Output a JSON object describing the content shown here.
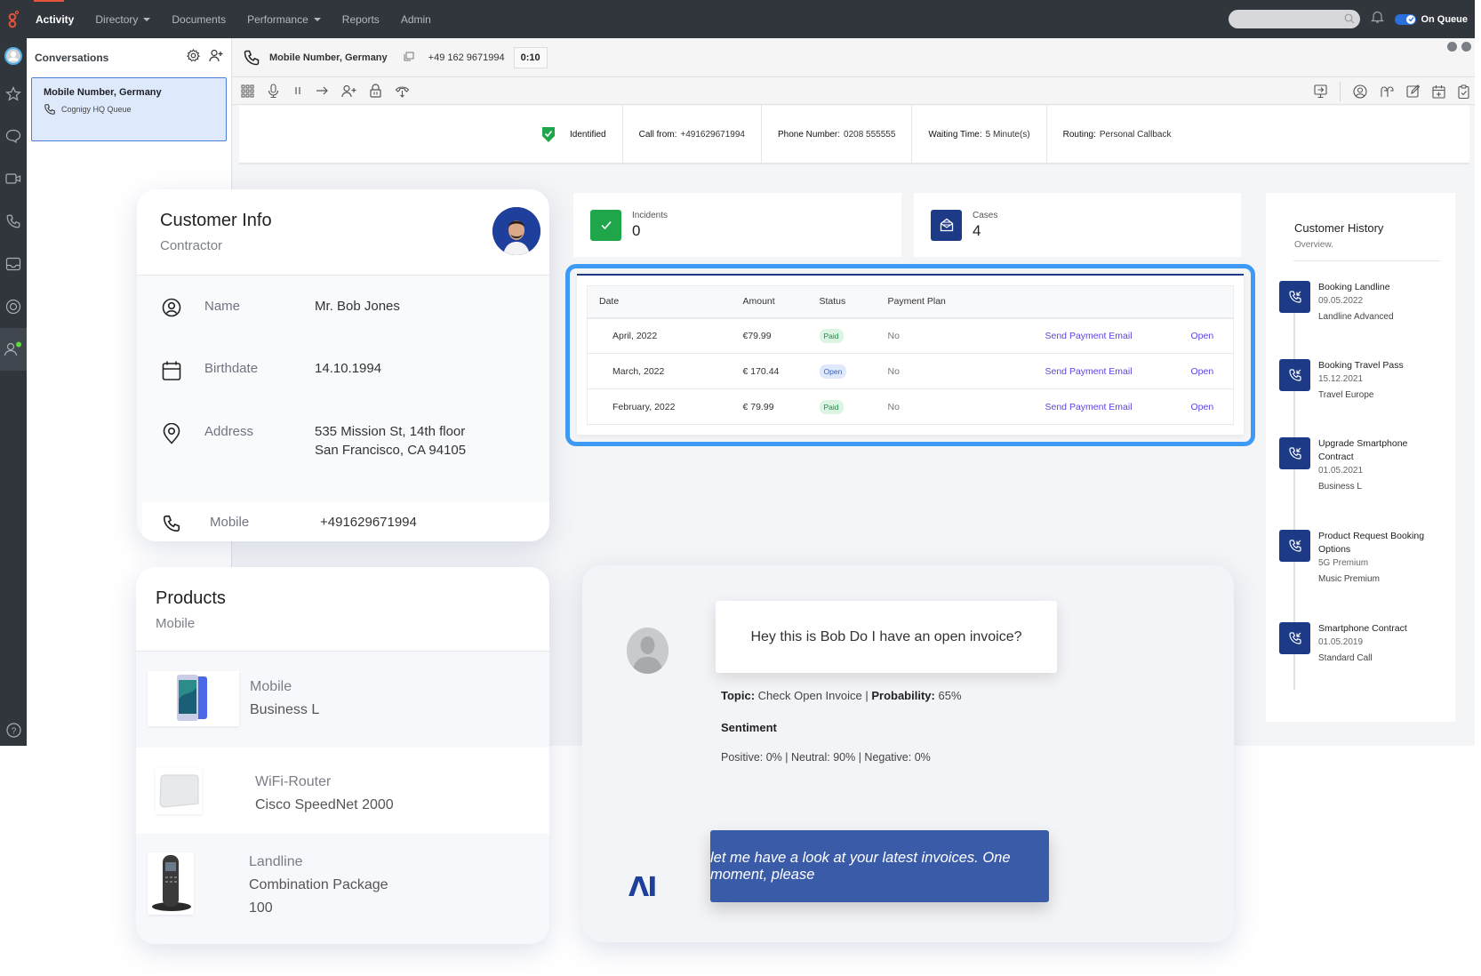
{
  "topnav": {
    "items": [
      {
        "label": "Activity",
        "active": true,
        "dropdown": false
      },
      {
        "label": "Directory",
        "active": false,
        "dropdown": true
      },
      {
        "label": "Documents",
        "active": false,
        "dropdown": false
      },
      {
        "label": "Performance",
        "active": false,
        "dropdown": true
      },
      {
        "label": "Reports",
        "active": false,
        "dropdown": false
      },
      {
        "label": "Admin",
        "active": false,
        "dropdown": false
      }
    ],
    "search_placeholder": "",
    "status_label": "On Queue",
    "brand_color": "#e5533a"
  },
  "leftrail": {
    "icons": [
      "avatar-icon",
      "star-icon",
      "chat-bubble-icon",
      "video-icon",
      "phone-icon",
      "inbox-icon",
      "lifebuoy-icon",
      "agent-status-icon"
    ],
    "help_icon": "help-icon"
  },
  "conversations": {
    "title": "Conversations",
    "items": [
      {
        "title": "Mobile Number, Germany",
        "queue": "Cognigy HQ Queue"
      }
    ]
  },
  "call": {
    "name": "Mobile Number, Germany",
    "number": "+49 162 9671994",
    "timer": "0:10"
  },
  "identification": {
    "status": "Identified",
    "fields": [
      {
        "label": "Call from:",
        "value": "+491629671994"
      },
      {
        "label": "Phone Number:",
        "value": "0208 555555"
      },
      {
        "label": "Waiting Time:",
        "value": "5 Minute(s)"
      },
      {
        "label": "Routing:",
        "value": "Personal Callback"
      }
    ]
  },
  "stats": {
    "incidents": {
      "label": "Incidents",
      "value": "0",
      "color": "#1fa64a"
    },
    "cases": {
      "label": "Cases",
      "value": "4",
      "color": "#1c3a86"
    }
  },
  "invoices": {
    "headers": [
      "Date",
      "Amount",
      "Status",
      "Payment Plan",
      "",
      ""
    ],
    "rows": [
      {
        "date": "April, 2022",
        "amount": "€79.99",
        "status": "Paid",
        "plan": "No",
        "action": "Send Payment Email",
        "open": "Open"
      },
      {
        "date": "March, 2022",
        "amount": "€ 170.44",
        "status": "Open",
        "plan": "No",
        "action": "Send Payment Email",
        "open": "Open"
      },
      {
        "date": "February, 2022",
        "amount": "€ 79.99",
        "status": "Paid",
        "plan": "No",
        "action": "Send Payment Email",
        "open": "Open"
      }
    ],
    "highlight_color": "#3d9bf5"
  },
  "history": {
    "title": "Customer History",
    "subtitle": "Overview.",
    "items": [
      {
        "title": "Booking Landline",
        "date": "09.05.2022",
        "detail": "Landline Advanced"
      },
      {
        "title": "Booking Travel Pass",
        "date": "15.12.2021",
        "detail": "Travel Europe"
      },
      {
        "title": "Upgrade Smartphone Contract",
        "date": "01.05.2021",
        "detail": "Business L"
      },
      {
        "title": "Product Request Booking Options",
        "date": "5G Premium",
        "detail": "Music Premium"
      },
      {
        "title": "Smartphone Contract",
        "date": "01.05.2019",
        "detail": "Standard Call"
      }
    ]
  },
  "customer_info": {
    "title": "Customer Info",
    "subtitle": "Contractor",
    "fields": [
      {
        "icon": "user-circle-icon",
        "label": "Name",
        "value": "Mr. Bob Jones"
      },
      {
        "icon": "calendar-icon",
        "label": "Birthdate",
        "value": "14.10.1994"
      },
      {
        "icon": "location-pin-icon",
        "label": "Address",
        "value": "535 Mission St, 14th floor",
        "value2": "San Francisco, CA 94105"
      },
      {
        "icon": "phone-icon",
        "label": "Mobile",
        "value": "+491629671994"
      }
    ]
  },
  "products": {
    "title": "Products",
    "subtitle": "Mobile",
    "items": [
      {
        "image": "smartphone",
        "name": "Mobile",
        "detail": "Business L",
        "detail2": ""
      },
      {
        "image": "wifi-router",
        "name": "WiFi-Router",
        "detail": "Cisco SpeedNet 2000",
        "detail2": ""
      },
      {
        "image": "landline-phone",
        "name": "Landline",
        "detail": "Combination Package",
        "detail2": "100"
      }
    ]
  },
  "chat": {
    "user_message": "Hey this is Bob Do I have an open invoice?",
    "topic_label": "Topic:",
    "topic_value": "Check Open Invoice",
    "probability_label": "Probability:",
    "probability_value": "65%",
    "sentiment_title": "Sentiment",
    "sentiment_text": "Positive: 0% | Neutral: 90% | Negative: 0%",
    "ai_logo": "ΛI",
    "ai_message": "let me have a look at your latest invoices. One moment, please"
  }
}
